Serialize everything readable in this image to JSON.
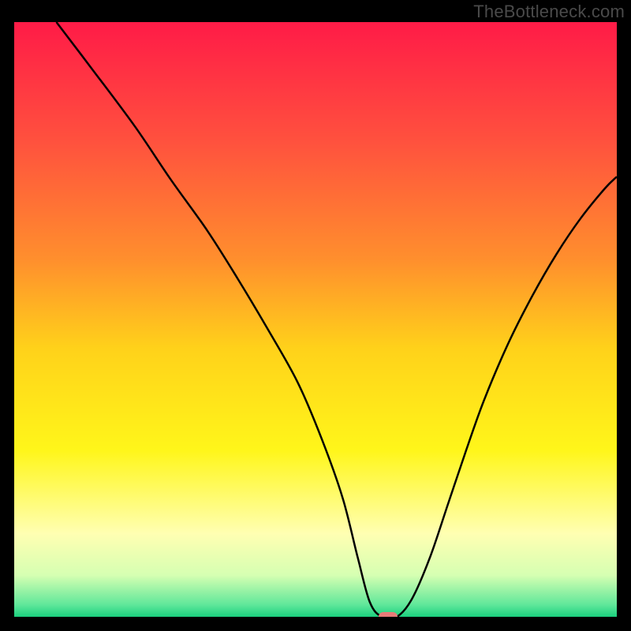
{
  "watermark": "TheBottleneck.com",
  "chart_data": {
    "type": "line",
    "title": "",
    "xlabel": "",
    "ylabel": "",
    "xlim": [
      0,
      100
    ],
    "ylim": [
      0,
      100
    ],
    "grid": false,
    "legend": false,
    "background_gradient": {
      "stops": [
        {
          "pos": 0.0,
          "color": "#ff1b47"
        },
        {
          "pos": 0.2,
          "color": "#ff513e"
        },
        {
          "pos": 0.4,
          "color": "#ff8f2d"
        },
        {
          "pos": 0.55,
          "color": "#ffd21a"
        },
        {
          "pos": 0.72,
          "color": "#fff61a"
        },
        {
          "pos": 0.86,
          "color": "#ffffb2"
        },
        {
          "pos": 0.93,
          "color": "#d6ffb2"
        },
        {
          "pos": 0.98,
          "color": "#5fe79a"
        },
        {
          "pos": 1.0,
          "color": "#1bd07e"
        }
      ]
    },
    "series": [
      {
        "name": "bottleneck-curve",
        "color": "#000000",
        "x": [
          7.0,
          13.0,
          20.0,
          26.0,
          32.0,
          37.0,
          42.0,
          47.0,
          51.0,
          54.5,
          57.0,
          59.0,
          61.0,
          63.5,
          66.0,
          69.0,
          72.0,
          75.0,
          78.0,
          82.0,
          86.0,
          90.0,
          94.0,
          98.0,
          100.0
        ],
        "y": [
          100.0,
          92.0,
          82.5,
          73.5,
          65.0,
          57.0,
          48.5,
          39.5,
          30.0,
          20.0,
          10.0,
          2.5,
          0.0,
          0.0,
          3.0,
          10.0,
          19.0,
          28.0,
          36.5,
          46.0,
          54.0,
          61.0,
          67.0,
          72.0,
          74.0
        ]
      }
    ],
    "marker": {
      "name": "optimal-point",
      "x": 62.0,
      "y": 0.0,
      "color": "#e77b78"
    }
  }
}
